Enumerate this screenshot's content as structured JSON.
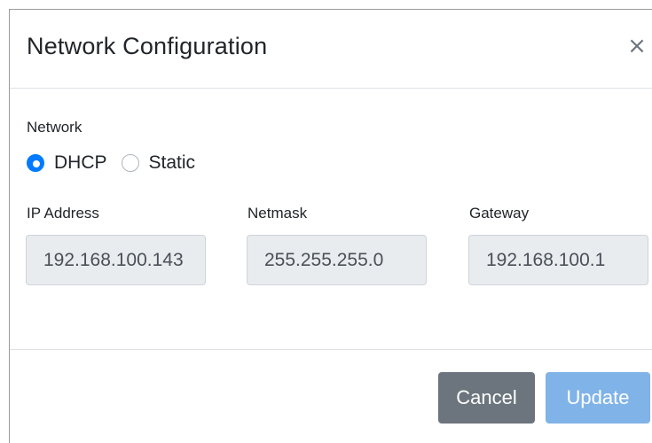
{
  "dialog": {
    "title": "Network Configuration",
    "close_glyph": "×",
    "close_icon": "close-icon"
  },
  "network": {
    "label": "Network",
    "options": [
      {
        "label": "DHCP",
        "checked": true
      },
      {
        "label": "Static",
        "checked": false
      }
    ]
  },
  "fields": {
    "ip_address": {
      "label": "IP Address",
      "value": "192.168.100.143"
    },
    "netmask": {
      "label": "Netmask",
      "value": "255.255.255.0"
    },
    "gateway": {
      "label": "Gateway",
      "value": "192.168.100.1"
    }
  },
  "footer": {
    "cancel_label": "Cancel",
    "update_label": "Update"
  },
  "colors": {
    "primary": "#007bff",
    "primary_disabled": "#80b3e8",
    "secondary": "#6c757d",
    "input_readonly_bg": "#e9ecef"
  }
}
